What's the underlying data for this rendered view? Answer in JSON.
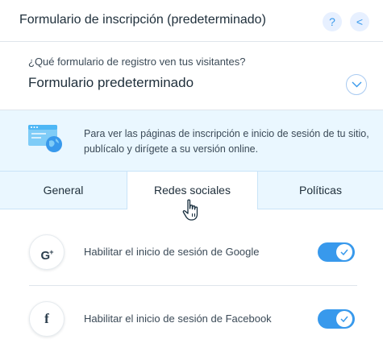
{
  "header": {
    "title": "Formulario de inscripción (predeterminado)",
    "help_label": "?",
    "back_label": "<"
  },
  "form_selector": {
    "label": "¿Qué formulario de registro ven tus visitantes?",
    "value": "Formulario predeterminado"
  },
  "info": {
    "text": "Para ver las páginas de inscripción e inicio de sesión de tu sitio, publícalo y dirígete a su versión online."
  },
  "tabs": [
    {
      "label": "General",
      "selected": false
    },
    {
      "label": "Redes sociales",
      "selected": true
    },
    {
      "label": "Políticas",
      "selected": false
    }
  ],
  "social_logins": [
    {
      "icon": "google-plus-icon",
      "glyph": "G",
      "glyph_sup": "+",
      "label": "Habilitar el inicio de sesión de Google",
      "enabled": true
    },
    {
      "icon": "facebook-icon",
      "glyph": "f",
      "label": "Habilitar el inicio de sesión de Facebook",
      "enabled": true
    }
  ],
  "colors": {
    "accent": "#3899ec",
    "info_background": "#eaf7ff",
    "text": "#20303c"
  }
}
